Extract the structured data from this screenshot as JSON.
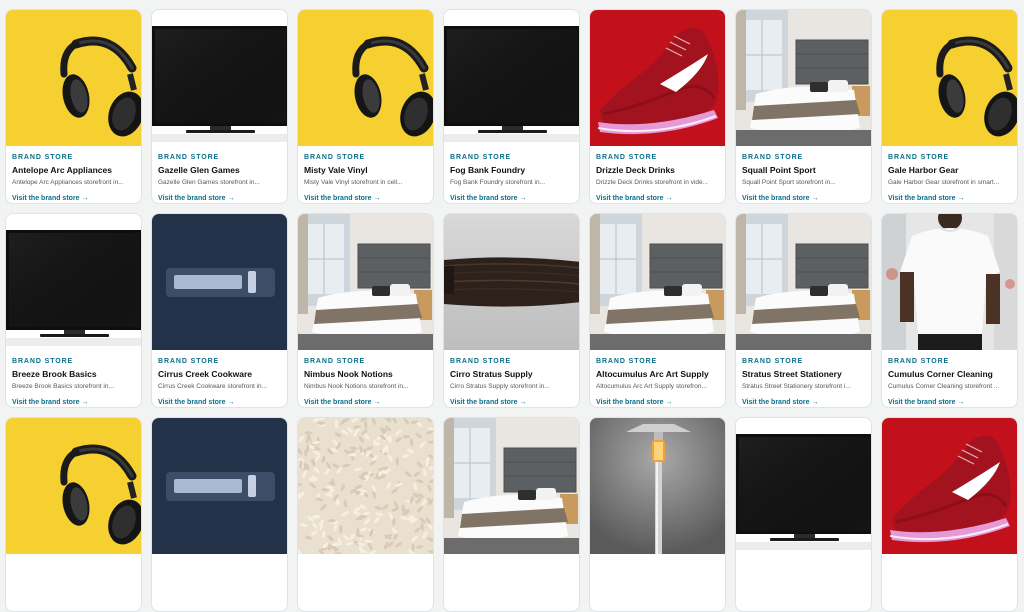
{
  "cards": [
    {
      "image": "headphones-image",
      "kicker": "BRAND STORE",
      "name": "Antelope Arc Appliances",
      "desc": "Antelope Arc Appliances storefront in...",
      "link": "Visit the brand store →"
    },
    {
      "image": "television-image",
      "kicker": "BRAND STORE",
      "name": "Gazelle Glen Games",
      "desc": "Gazelle Glen Games storefront in...",
      "link": "Visit the brand store →"
    },
    {
      "image": "headphones-image",
      "kicker": "BRAND STORE",
      "name": "Misty Vale Vinyl",
      "desc": "Misty Vale Vinyl storefront in cell...",
      "link": "Visit the brand store →"
    },
    {
      "image": "television-image",
      "kicker": "BRAND STORE",
      "name": "Fog Bank Foundry",
      "desc": "Fog Bank Foundry storefront in...",
      "link": "Visit the brand store →"
    },
    {
      "image": "sneaker-image",
      "kicker": "BRAND STORE",
      "name": "Drizzle Deck Drinks",
      "desc": "Drizzle Deck Drinks storefront in vide...",
      "link": "Visit the brand store →"
    },
    {
      "image": "hotel-bed-image",
      "kicker": "BRAND STORE",
      "name": "Squall Point Sport",
      "desc": "Squall Point Sport storefront in...",
      "link": "Visit the brand store →"
    },
    {
      "image": "headphones-image",
      "kicker": "BRAND STORE",
      "name": "Gale Harbor Gear",
      "desc": "Gale Harbor Gear storefront in smart...",
      "link": "Visit the brand store →"
    },
    {
      "image": "television-image",
      "kicker": "BRAND STORE",
      "name": "Breeze Brook Basics",
      "desc": "Breeze Brook Basics storefront in...",
      "link": "Visit the brand store →"
    },
    {
      "image": "placeholder-image",
      "kicker": "BRAND STORE",
      "name": "Cirrus Creek Cookware",
      "desc": "Cirrus Creek Cookware storefront in...",
      "link": "Visit the brand store →"
    },
    {
      "image": "hotel-bed-image",
      "kicker": "BRAND STORE",
      "name": "Nimbus Nook Notions",
      "desc": "Nimbus Nook Notions storefront in...",
      "link": "Visit the brand store →"
    },
    {
      "image": "hair-extension-image",
      "kicker": "BRAND STORE",
      "name": "Cirro Stratus Supply",
      "desc": "Cirro Stratus Supply storefront in...",
      "link": "Visit the brand store →"
    },
    {
      "image": "hotel-bed-image",
      "kicker": "BRAND STORE",
      "name": "Altocumulus Arc Art Supply",
      "desc": "Altocumulus Arc Art Supply storefron...",
      "link": "Visit the brand store →"
    },
    {
      "image": "hotel-bed-image",
      "kicker": "BRAND STORE",
      "name": "Stratus Street Stationery",
      "desc": "Stratus Street Stationery storefront i...",
      "link": "Visit the brand store →"
    },
    {
      "image": "tshirt-image",
      "kicker": "BRAND STORE",
      "name": "Cumulus Corner Cleaning",
      "desc": "Cumulus Corner Cleaning storefront ...",
      "link": "Visit the brand store →"
    },
    {
      "image": "headphones-image",
      "kicker": "",
      "name": "",
      "desc": "",
      "link": ""
    },
    {
      "image": "placeholder-image",
      "kicker": "",
      "name": "",
      "desc": "",
      "link": ""
    },
    {
      "image": "rice-image",
      "kicker": "",
      "name": "",
      "desc": "",
      "link": ""
    },
    {
      "image": "hotel-bed-image",
      "kicker": "",
      "name": "",
      "desc": "",
      "link": ""
    },
    {
      "image": "patio-heater-image",
      "kicker": "",
      "name": "",
      "desc": "",
      "link": ""
    },
    {
      "image": "television-image",
      "kicker": "",
      "name": "",
      "desc": "",
      "link": ""
    },
    {
      "image": "sneaker-image",
      "kicker": "",
      "name": "",
      "desc": "",
      "link": ""
    }
  ],
  "colors": {
    "accent": "#0a6f8a",
    "yellow": "#f7cf32",
    "red": "#c2121b",
    "navy": "#233149"
  }
}
